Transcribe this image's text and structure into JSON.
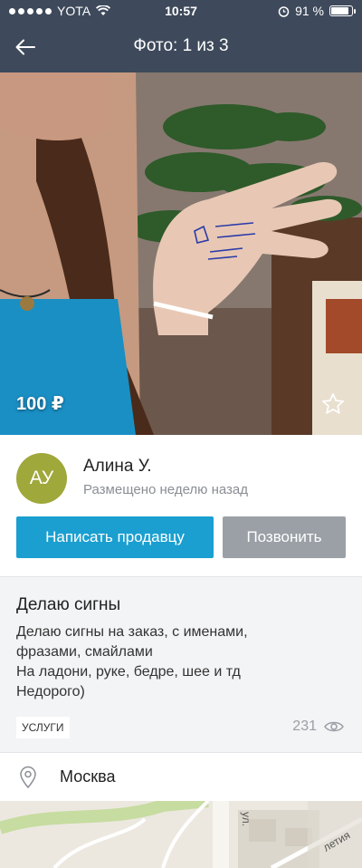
{
  "status_bar": {
    "carrier": "YOTA",
    "time": "10:57",
    "battery_text": "91 %",
    "battery_level": 0.91
  },
  "header": {
    "title": "Фото: 1 из 3"
  },
  "photo": {
    "price": "100 ₽"
  },
  "seller": {
    "initials": "АУ",
    "name": "Алина У.",
    "posted": "Размещено неделю назад",
    "message_button": "Написать продавцу",
    "call_button": "Позвонить"
  },
  "listing": {
    "title": "Делаю сигны",
    "description_lines": [
      "Делаю сигны на заказ, с именами,",
      "фразами, смайлами",
      "На ладони, руке, бедре,  шее и тд",
      "Недорого)"
    ],
    "category_tag": "УСЛУГИ",
    "views": "231"
  },
  "location": {
    "city": "Москва"
  },
  "map": {
    "street_label_1": "ул.",
    "street_label_2": "летия"
  },
  "colors": {
    "header_bg": "#3e4a5b",
    "primary_button": "#1a9fd0",
    "secondary_button": "#9aa0a6",
    "avatar_bg": "#9fa83a"
  },
  "icons": [
    "back-arrow-icon",
    "wifi-icon",
    "alarm-icon",
    "battery-icon",
    "star-icon",
    "eye-icon",
    "location-pin-icon"
  ]
}
